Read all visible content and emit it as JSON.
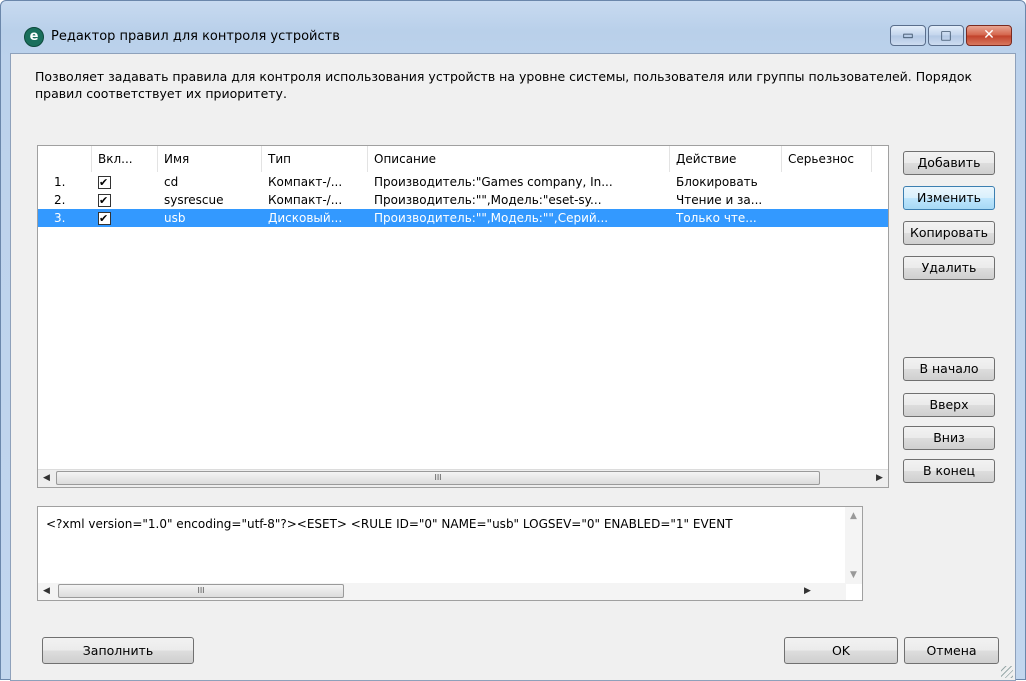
{
  "window": {
    "icon_letter": "e",
    "title": "Редактор правил для контроля устройств",
    "minimize_glyph": "▭",
    "maximize_glyph": "□",
    "close_glyph": "✕"
  },
  "description": "Позволяет задавать правила для контроля использования устройств на уровне системы, пользователя или группы пользователей. Порядок правил соответствует их приоритету.",
  "table": {
    "columns": [
      "",
      "Вкл...",
      "Имя",
      "Тип",
      "Описание",
      "Действие",
      "Серьезнос"
    ],
    "rows": [
      {
        "num": "1.",
        "enabled": true,
        "name": "cd",
        "type": "Компакт-/...",
        "desc": "Производитель:\"Games company, In...",
        "action": "Блокировать",
        "severity": ""
      },
      {
        "num": "2.",
        "enabled": true,
        "name": "sysrescue",
        "type": "Компакт-/...",
        "desc": "Производитель:\"\",Модель:\"eset-sy...",
        "action": "Чтение и за...",
        "severity": ""
      },
      {
        "num": "3.",
        "enabled": true,
        "name": "usb",
        "type": "Дисковый...",
        "desc": "Производитель:\"\",Модель:\"\",Серий...",
        "action": "Только чте...",
        "severity": ""
      }
    ],
    "selected_row": 3,
    "scroll_thumb_glyph": "III"
  },
  "buttons": {
    "add": "Добавить",
    "edit": "Изменить",
    "copy": "Копировать",
    "delete": "Удалить",
    "to_top": "В начало",
    "up": "Вверх",
    "down": "Вниз",
    "to_bottom": "В конец",
    "populate": "Заполнить",
    "ok": "OK",
    "cancel": "Отмена"
  },
  "xml_preview": "<?xml version=\"1.0\" encoding=\"utf-8\"?><ESET> <RULE ID=\"0\" NAME=\"usb\" LOGSEV=\"0\" ENABLED=\"1\" EVENT",
  "colors": {
    "selection": "#3399ff",
    "title_bar": "#b9d0ea",
    "close_button": "#c1402a"
  }
}
